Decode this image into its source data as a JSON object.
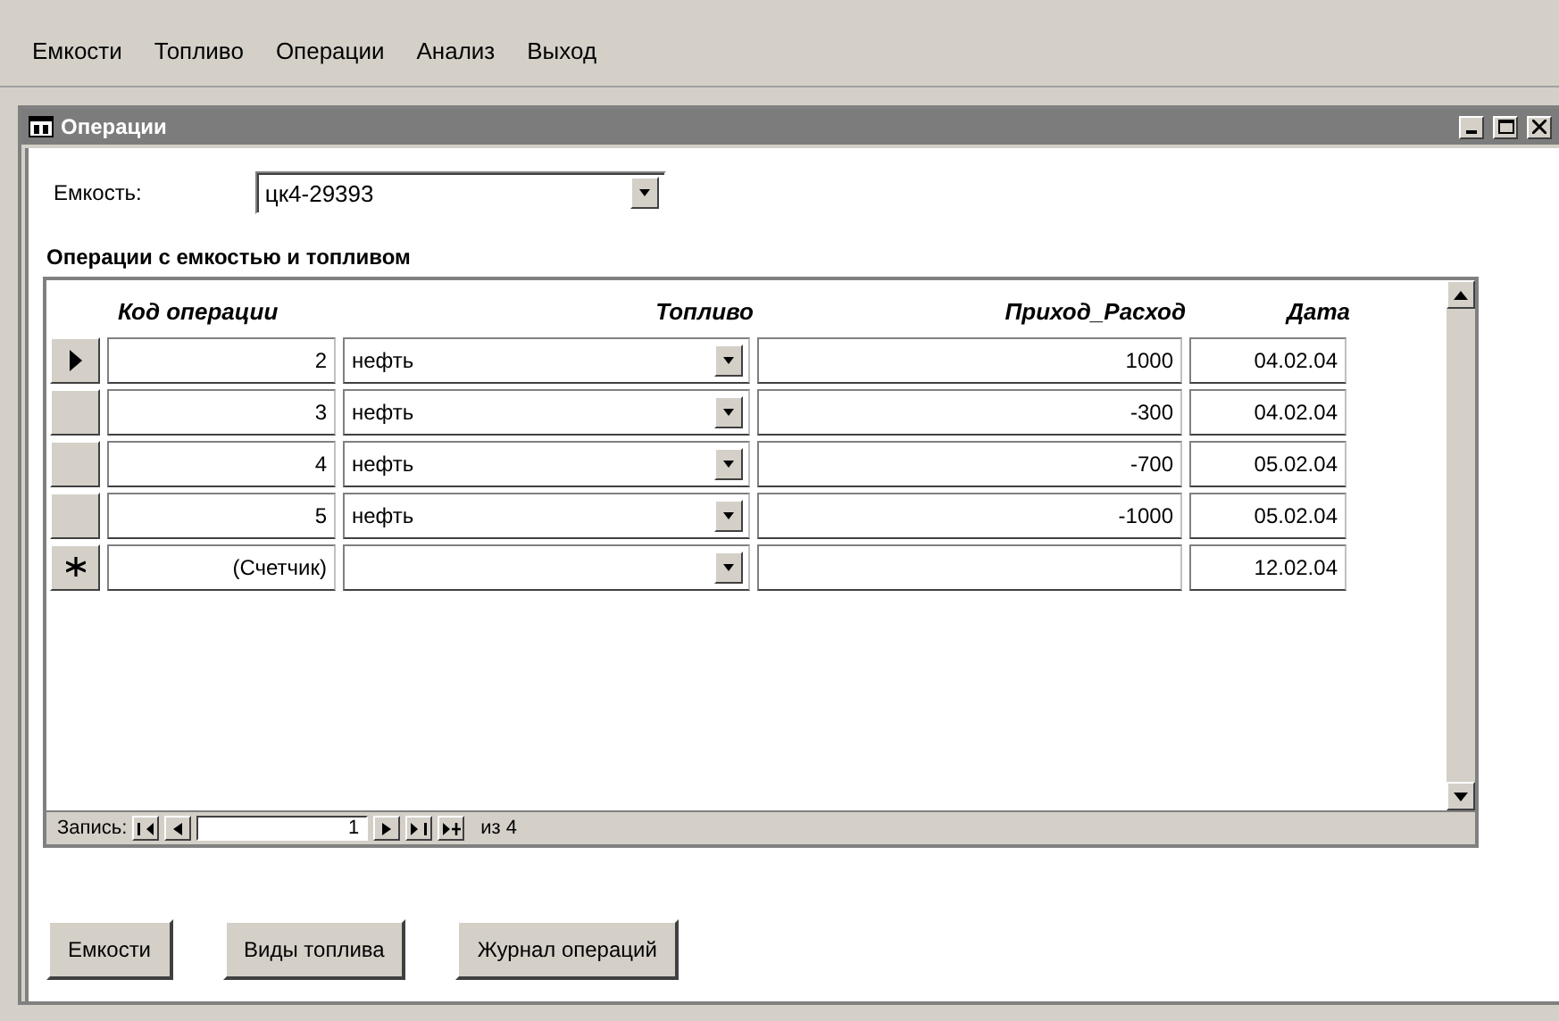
{
  "menu": [
    "Емкости",
    "Топливо",
    "Операции",
    "Анализ",
    "Выход"
  ],
  "window": {
    "title": "Операции"
  },
  "tank": {
    "label": "Емкость:",
    "value": "цк4-29393"
  },
  "subform": {
    "label": "Операции с емкостью и топливом",
    "columns": [
      "Код операции",
      "Топливо",
      "Приход_Расход",
      "Дата"
    ],
    "rows": [
      {
        "kind": "current",
        "code": "2",
        "fuel": "нефть",
        "amount": "1000",
        "date": "04.02.04"
      },
      {
        "kind": "record",
        "code": "3",
        "fuel": "нефть",
        "amount": "-300",
        "date": "04.02.04"
      },
      {
        "kind": "record",
        "code": "4",
        "fuel": "нефть",
        "amount": "-700",
        "date": "05.02.04"
      },
      {
        "kind": "record",
        "code": "5",
        "fuel": "нефть",
        "amount": "-1000",
        "date": "05.02.04"
      },
      {
        "kind": "new",
        "code": "(Счетчик)",
        "fuel": "",
        "amount": "",
        "date": "12.02.04"
      }
    ],
    "navigator": {
      "label": "Запись:",
      "current": "1",
      "total": "из 4"
    }
  },
  "buttons": [
    "Емкости",
    "Виды топлива",
    "Журнал операций"
  ]
}
